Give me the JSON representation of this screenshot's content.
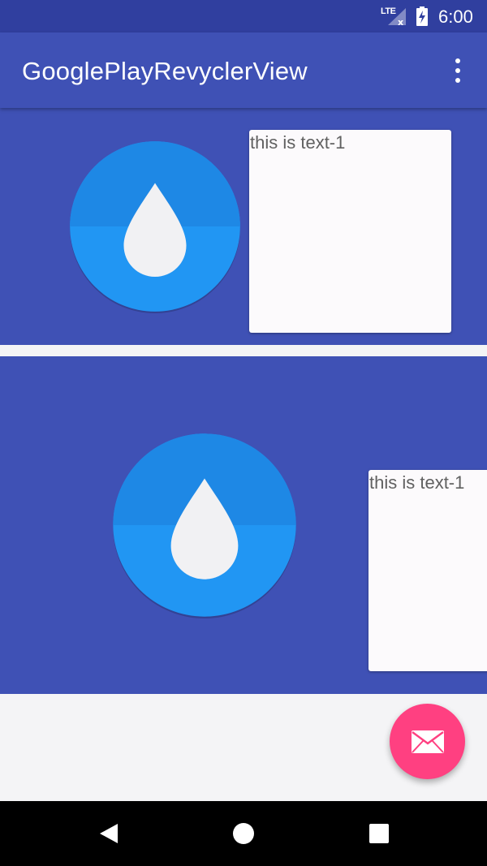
{
  "status_bar": {
    "network_label": "LTE",
    "time": "6:00",
    "icons": [
      "signal-icon",
      "battery-charging-icon"
    ]
  },
  "app_bar": {
    "title": "GooglePlayRevyclerView",
    "overflow_icon": "more-vert-icon"
  },
  "list": {
    "items": [
      {
        "image": "water-drop-icon",
        "text": "this is text-1"
      },
      {
        "image": "water-drop-icon",
        "text": "this is text-1"
      }
    ]
  },
  "fab": {
    "icon": "mail-icon"
  },
  "nav_bar": {
    "buttons": [
      "back-icon",
      "home-icon",
      "recents-icon"
    ]
  },
  "colors": {
    "primary": "#3f51b5",
    "primary_dark": "#303f9f",
    "accent": "#ff4081",
    "drop_circle": "#2196f3"
  }
}
